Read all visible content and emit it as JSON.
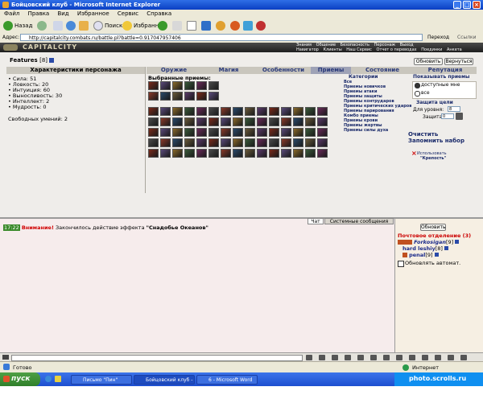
{
  "window": {
    "title": "Бойцовский клуб - Microsoft Internet Explorer"
  },
  "menu": [
    "Файл",
    "Правка",
    "Вид",
    "Избранное",
    "Сервис",
    "Справка"
  ],
  "toolbar": {
    "back": "Назад",
    "search": "Поиск",
    "favorites": "Избранное"
  },
  "address": {
    "label": "Адрес:",
    "url": "http://capitalcity.combats.ru/battle.pl?battle=0.917047957406",
    "go": "Переход",
    "links": "Ссылки"
  },
  "game": {
    "logo": "CAPITALCITY",
    "nav_top": [
      "Знания",
      "Общение",
      "Безопасность",
      "Персонаж",
      "Выход"
    ],
    "nav_bottom": [
      "Навигатор",
      "Клиенты",
      "Наш Сервис",
      "Отчет о переводах",
      "Поединки",
      "Анкета"
    ]
  },
  "features": {
    "title": "Features",
    "level": "[8]"
  },
  "buttons": {
    "refresh": "Обновить",
    "back": "Вернуться"
  },
  "left_panel": {
    "header": "Характеристики персонажа",
    "stats": [
      "Сила: 51",
      "Ловкость: 20",
      "Интуиция: 60",
      "Выносливость: 30",
      "Интеллект: 2",
      "Мудрость: 0"
    ],
    "free_points": "Свободных умений: 2"
  },
  "tabs": [
    "Оружие",
    "Магия",
    "Особенности",
    "Приемы",
    "Состояние",
    "Репутация"
  ],
  "selected_tab": "Приемы",
  "skills": {
    "selected_label": "Выбранные приемы:"
  },
  "categories": {
    "header": "Категории",
    "items": [
      "Все",
      "Приемы новичков",
      "Приемы атаки",
      "Приемы защиты",
      "Приемы контрударов",
      "Приемы критических ударов",
      "Приемы парирования",
      "Комбо приемы",
      "Приемы крови",
      "Приемы жертвы",
      "Приемы силы духа"
    ]
  },
  "show_techniques": {
    "header": "Показывать приемы",
    "options": [
      "доступные мне",
      "все"
    ],
    "protection_header": "Защита цели",
    "level_label": "Для уровня:",
    "level_value": "8",
    "protect_label": "Защита:",
    "protect_value": "0",
    "clear": "Очистить",
    "remember": "Запомнить набор",
    "use_label": "Использовать",
    "use_item": "\"Крепость\""
  },
  "chat": {
    "tabs": [
      "Чат",
      "Системные сообщения"
    ],
    "time": "17:22",
    "warning": "Внимание!",
    "message_prefix": "Закончилось действие эффекта",
    "effect": "\"Снадобье Океанов\""
  },
  "right_panel": {
    "refresh": "Обновить",
    "mail_title": "Почтовое отделение (3)",
    "users": [
      {
        "name": "Forkosigan",
        "level": "[9]"
      },
      {
        "name": "hard leshiy",
        "level": "[8]"
      },
      {
        "name": "penal",
        "level": "[9]"
      }
    ],
    "auto_refresh": "Обновлять автомат."
  },
  "status": {
    "left": "Готово",
    "right": "Интернет"
  },
  "taskbar": {
    "start": "пуск",
    "items": [
      "Письмо \"Пин\"",
      "Бойцовский клуб - M...",
      "6 - Microsoft Word"
    ],
    "watermark": "photo.scrolls.ru"
  },
  "colors": {
    "title_bar": "#0a3fc2",
    "tab_bar": "#c9c6bd",
    "chat_bg": "#f6ecec",
    "warning": "#d00000"
  }
}
